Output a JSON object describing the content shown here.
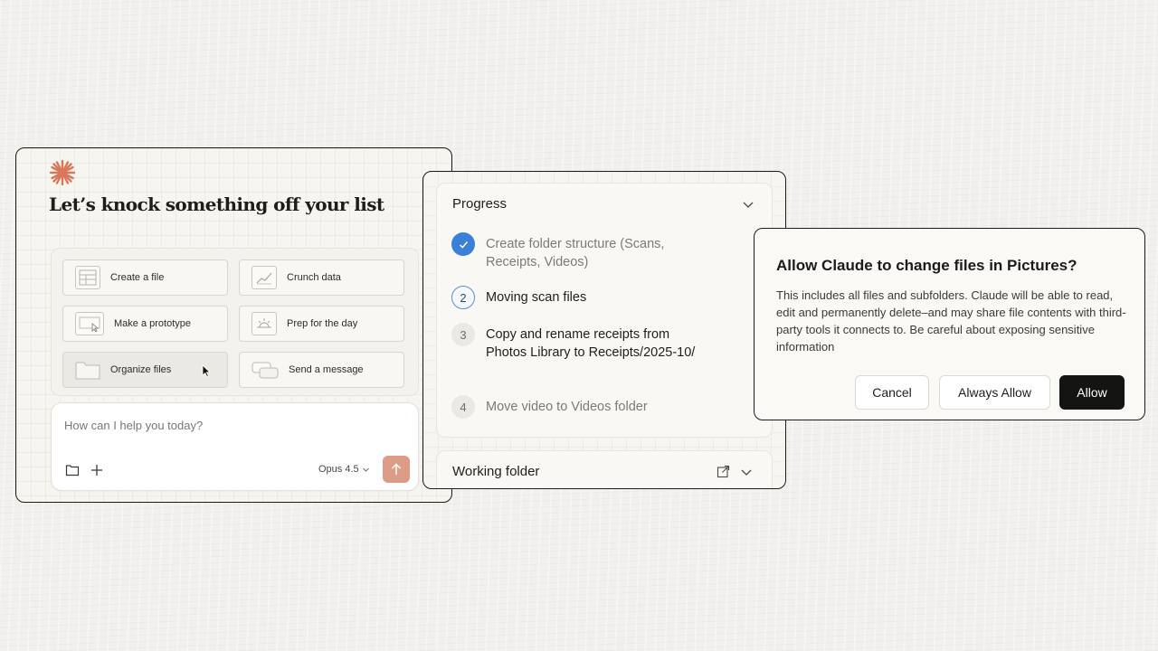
{
  "home": {
    "title": "Let’s knock something off your list",
    "logo_icon": "claude-spark-icon",
    "suggestions": [
      {
        "label": "Create a file",
        "icon": "file-icon"
      },
      {
        "label": "Crunch data",
        "icon": "chart-icon"
      },
      {
        "label": "Make a prototype",
        "icon": "prototype-icon"
      },
      {
        "label": "Prep for the day",
        "icon": "sunrise-icon"
      },
      {
        "label": "Organize files",
        "icon": "folder-icon"
      },
      {
        "label": "Send a message",
        "icon": "message-icon"
      }
    ],
    "composer": {
      "placeholder": "How can I help you today?",
      "model": "Opus 4.5"
    }
  },
  "progress": {
    "title": "Progress",
    "steps": [
      {
        "marker": "",
        "status": "done",
        "text": "Create folder structure (Scans, Receipts, Videos)"
      },
      {
        "marker": "2",
        "status": "current",
        "text": "Moving scan files"
      },
      {
        "marker": "3",
        "status": "todo",
        "text": "Copy and rename receipts from Photos Library to Receipts/2025-10/"
      },
      {
        "marker": "4",
        "status": "todo",
        "text": "Move video to Videos folder"
      }
    ],
    "working_folder": {
      "title": "Working folder"
    }
  },
  "dialog": {
    "title": "Allow Claude to change files in Pictures?",
    "body": "This includes all files and subfolders. Claude will be able to read, edit and permanently delete–and may share file contents with third-party tools it connects to. Be careful about exposing sensitive information",
    "cancel": "Cancel",
    "always_allow": "Always Allow",
    "allow": "Allow"
  },
  "colors": {
    "accent": "#d9775b",
    "check_blue": "#3b7fd9",
    "send_button": "#dc9c88",
    "primary_button": "#141413"
  }
}
